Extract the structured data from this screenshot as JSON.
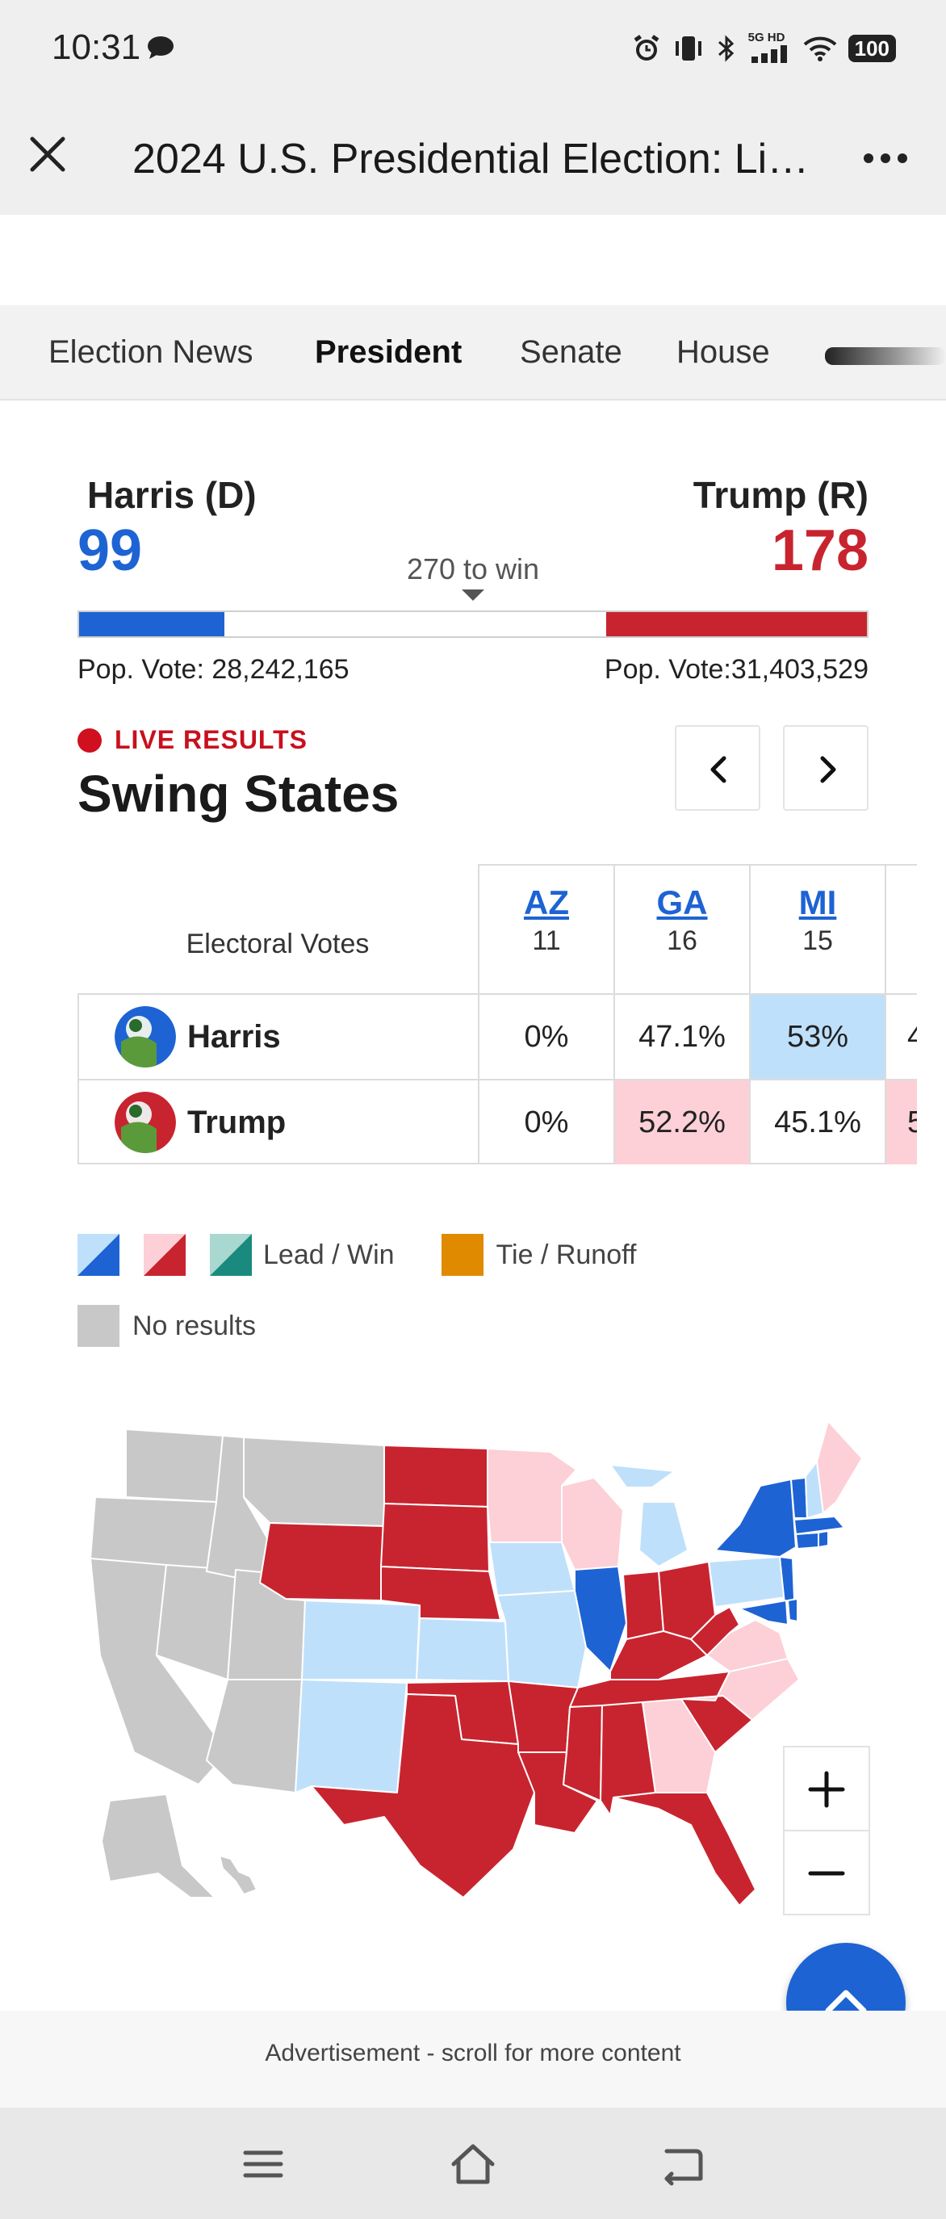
{
  "status_bar": {
    "time": "10:31",
    "network": "5G HD",
    "battery": "100",
    "icons": [
      "chat-bubble-icon",
      "alarm-icon",
      "vibrate-icon",
      "bluetooth-icon",
      "cell-signal-icon",
      "wifi-icon",
      "battery-icon"
    ]
  },
  "header": {
    "title": "2024 U.S. Presidential Election: Li…",
    "close_icon": "close-icon",
    "menu_icon": "more-icon"
  },
  "tabs": [
    {
      "label": "Election News",
      "active": false
    },
    {
      "label": "President",
      "active": true
    },
    {
      "label": "Senate",
      "active": false
    },
    {
      "label": "House",
      "active": false
    }
  ],
  "race": {
    "dem": {
      "name": "Harris (D)",
      "electoral_votes": "99",
      "pop_vote": "Pop. Vote: 28,242,165",
      "color": "#1e63d3"
    },
    "rep": {
      "name": "Trump (R)",
      "electoral_votes": "178",
      "pop_vote": "Pop. Vote:31,403,529",
      "color": "#c8242f"
    },
    "to_win": "270 to win",
    "total_electoral_votes": 538,
    "dem_share": 0.184,
    "rep_share": 0.331
  },
  "live": {
    "label": "LIVE RESULTS",
    "title": "Swing States"
  },
  "swing_table": {
    "header_label": "Electoral Votes",
    "states": [
      {
        "abbr": "AZ",
        "ev": "11"
      },
      {
        "abbr": "GA",
        "ev": "16"
      },
      {
        "abbr": "MI",
        "ev": "15"
      },
      {
        "abbr": "",
        "ev": ""
      }
    ],
    "rows": [
      {
        "candidate": "Harris",
        "values": [
          "0%",
          "47.1%",
          "53%",
          "4"
        ],
        "lead": [
          false,
          false,
          true,
          true
        ]
      },
      {
        "candidate": "Trump",
        "values": [
          "0%",
          "52.2%",
          "45.1%",
          "5"
        ],
        "lead": [
          false,
          true,
          false,
          true
        ]
      }
    ]
  },
  "legend": {
    "lead_win": "Lead / Win",
    "tie_runoff": "Tie / Runoff",
    "no_results": "No results",
    "colors": {
      "dem_lead": "#bfe0fb",
      "dem_win": "#1e63d3",
      "rep_lead": "#fcd0d6",
      "rep_win": "#c8242f",
      "other_lead": "#a8d8d0",
      "other_win": "#1a8a7e",
      "tie": "#e08a00",
      "none": "#c8c8c8"
    }
  },
  "map": {
    "zoom_in": "+",
    "zoom_out": "−"
  },
  "ad": {
    "text": "Advertisement - scroll for more content"
  },
  "system_nav": [
    "menu-icon",
    "home-icon",
    "back-icon"
  ]
}
